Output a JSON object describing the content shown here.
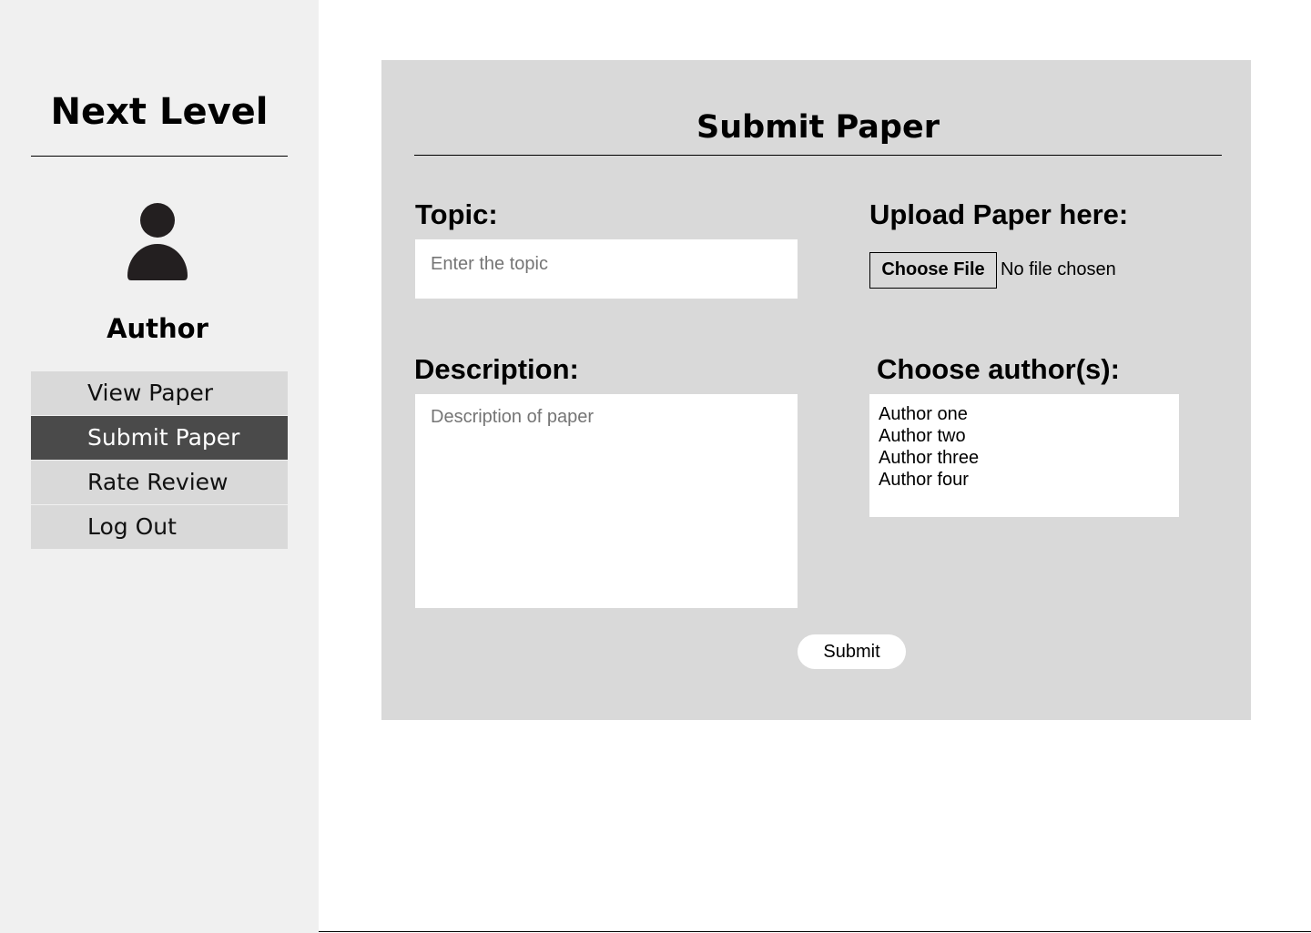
{
  "sidebar": {
    "brand": "Next Level",
    "role": "Author",
    "items": [
      {
        "label": "View Paper"
      },
      {
        "label": "Submit Paper"
      },
      {
        "label": "Rate Review"
      },
      {
        "label": "Log Out"
      }
    ]
  },
  "form": {
    "title": "Submit Paper",
    "topic_label": "Topic:",
    "topic_placeholder": "Enter the topic",
    "description_label": "Description:",
    "description_placeholder": "Description of paper",
    "upload_label": "Upload Paper here:",
    "choose_file": "Choose File",
    "file_status": "No file chosen",
    "authors_label": "Choose author(s):",
    "authors": [
      "Author one",
      "Author two",
      "Author three",
      "Author four"
    ],
    "submit": "Submit"
  }
}
